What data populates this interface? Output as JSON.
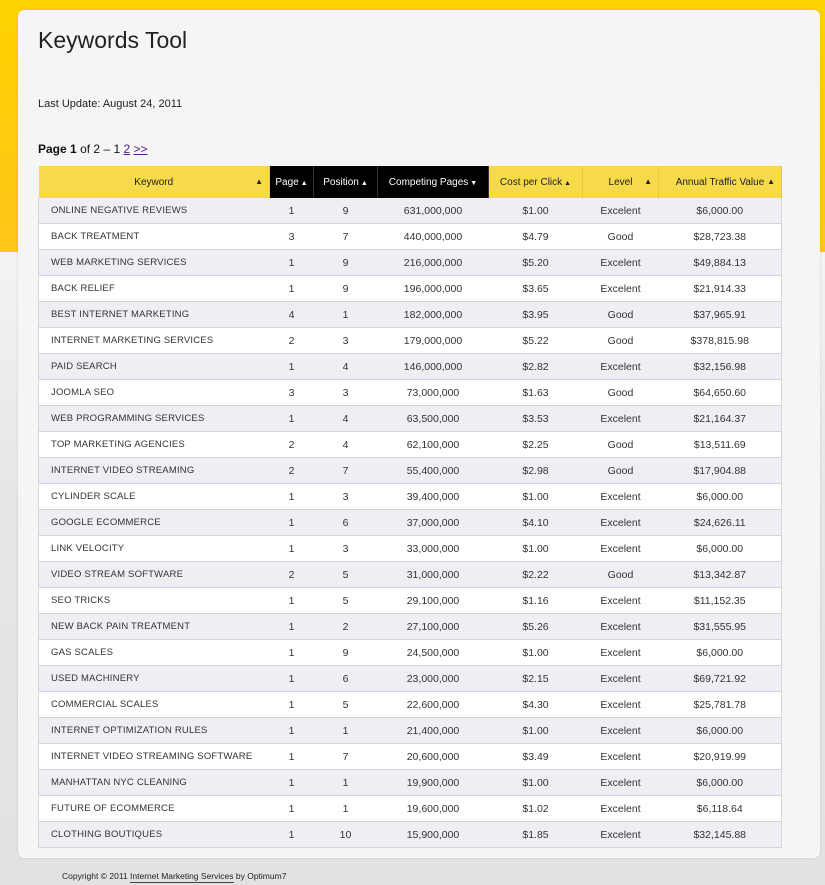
{
  "page": {
    "title": "Keywords Tool",
    "last_update": "Last Update: August 24, 2011"
  },
  "pagination": {
    "prefix": "Page",
    "current": "1",
    "of_label": "of",
    "total": "2",
    "dash": "–",
    "page1": "1",
    "page2": "2",
    "next": ">>"
  },
  "table": {
    "headers": {
      "keyword": "Keyword",
      "page": "Page",
      "position": "Position",
      "competing": "Competing Pages",
      "cpc": "Cost per Click",
      "level": "Level",
      "traffic": "Annual Traffic Value"
    },
    "rows": [
      [
        "ONLINE NEGATIVE REVIEWS",
        "1",
        "9",
        "631,000,000",
        "$1.00",
        "Excelent",
        "$6,000.00"
      ],
      [
        "BACK TREATMENT",
        "3",
        "7",
        "440,000,000",
        "$4.79",
        "Good",
        "$28,723.38"
      ],
      [
        "WEB MARKETING SERVICES",
        "1",
        "9",
        "216,000,000",
        "$5.20",
        "Excelent",
        "$49,884.13"
      ],
      [
        "BACK RELIEF",
        "1",
        "9",
        "196,000,000",
        "$3.65",
        "Excelent",
        "$21,914.33"
      ],
      [
        "BEST INTERNET MARKETING",
        "4",
        "1",
        "182,000,000",
        "$3.95",
        "Good",
        "$37,965.91"
      ],
      [
        "INTERNET MARKETING SERVICES",
        "2",
        "3",
        "179,000,000",
        "$5.22",
        "Good",
        "$378,815.98"
      ],
      [
        "PAID SEARCH",
        "1",
        "4",
        "146,000,000",
        "$2.82",
        "Excelent",
        "$32,156.98"
      ],
      [
        "JOOMLA SEO",
        "3",
        "3",
        "73,000,000",
        "$1.63",
        "Good",
        "$64,650.60"
      ],
      [
        "WEB PROGRAMMING SERVICES",
        "1",
        "4",
        "63,500,000",
        "$3.53",
        "Excelent",
        "$21,164.37"
      ],
      [
        "TOP MARKETING AGENCIES",
        "2",
        "4",
        "62,100,000",
        "$2.25",
        "Good",
        "$13,511.69"
      ],
      [
        "INTERNET VIDEO STREAMING",
        "2",
        "7",
        "55,400,000",
        "$2.98",
        "Good",
        "$17,904.88"
      ],
      [
        "CYLINDER SCALE",
        "1",
        "3",
        "39,400,000",
        "$1.00",
        "Excelent",
        "$6,000.00"
      ],
      [
        "GOOGLE ECOMMERCE",
        "1",
        "6",
        "37,000,000",
        "$4.10",
        "Excelent",
        "$24,626.11"
      ],
      [
        "LINK VELOCITY",
        "1",
        "3",
        "33,000,000",
        "$1.00",
        "Excelent",
        "$6,000.00"
      ],
      [
        "VIDEO STREAM SOFTWARE",
        "2",
        "5",
        "31,000,000",
        "$2.22",
        "Good",
        "$13,342.87"
      ],
      [
        "SEO TRICKS",
        "1",
        "5",
        "29,100,000",
        "$1.16",
        "Excelent",
        "$11,152.35"
      ],
      [
        "NEW BACK PAIN TREATMENT",
        "1",
        "2",
        "27,100,000",
        "$5.26",
        "Excelent",
        "$31,555.95"
      ],
      [
        "GAS SCALES",
        "1",
        "9",
        "24,500,000",
        "$1.00",
        "Excelent",
        "$6,000.00"
      ],
      [
        "USED MACHINERY",
        "1",
        "6",
        "23,000,000",
        "$2.15",
        "Excelent",
        "$69,721.92"
      ],
      [
        "COMMERCIAL SCALES",
        "1",
        "5",
        "22,600,000",
        "$4.30",
        "Excelent",
        "$25,781.78"
      ],
      [
        "INTERNET OPTIMIZATION RULES",
        "1",
        "1",
        "21,400,000",
        "$1.00",
        "Excelent",
        "$6,000.00"
      ],
      [
        "INTERNET VIDEO STREAMING SOFTWARE",
        "1",
        "7",
        "20,600,000",
        "$3.49",
        "Excelent",
        "$20,919.99"
      ],
      [
        "MANHATTAN NYC CLEANING",
        "1",
        "1",
        "19,900,000",
        "$1.00",
        "Excelent",
        "$6,000.00"
      ],
      [
        "FUTURE OF ECOMMERCE",
        "1",
        "1",
        "19,600,000",
        "$1.02",
        "Excelent",
        "$6,118.64"
      ],
      [
        "CLOTHING BOUTIQUES",
        "1",
        "10",
        "15,900,000",
        "$1.85",
        "Excelent",
        "$32,145.88"
      ]
    ]
  },
  "footer": {
    "copyright": "Copyright © 2011",
    "link": "Internet Marketing Services",
    "by": "by Optimum7"
  }
}
